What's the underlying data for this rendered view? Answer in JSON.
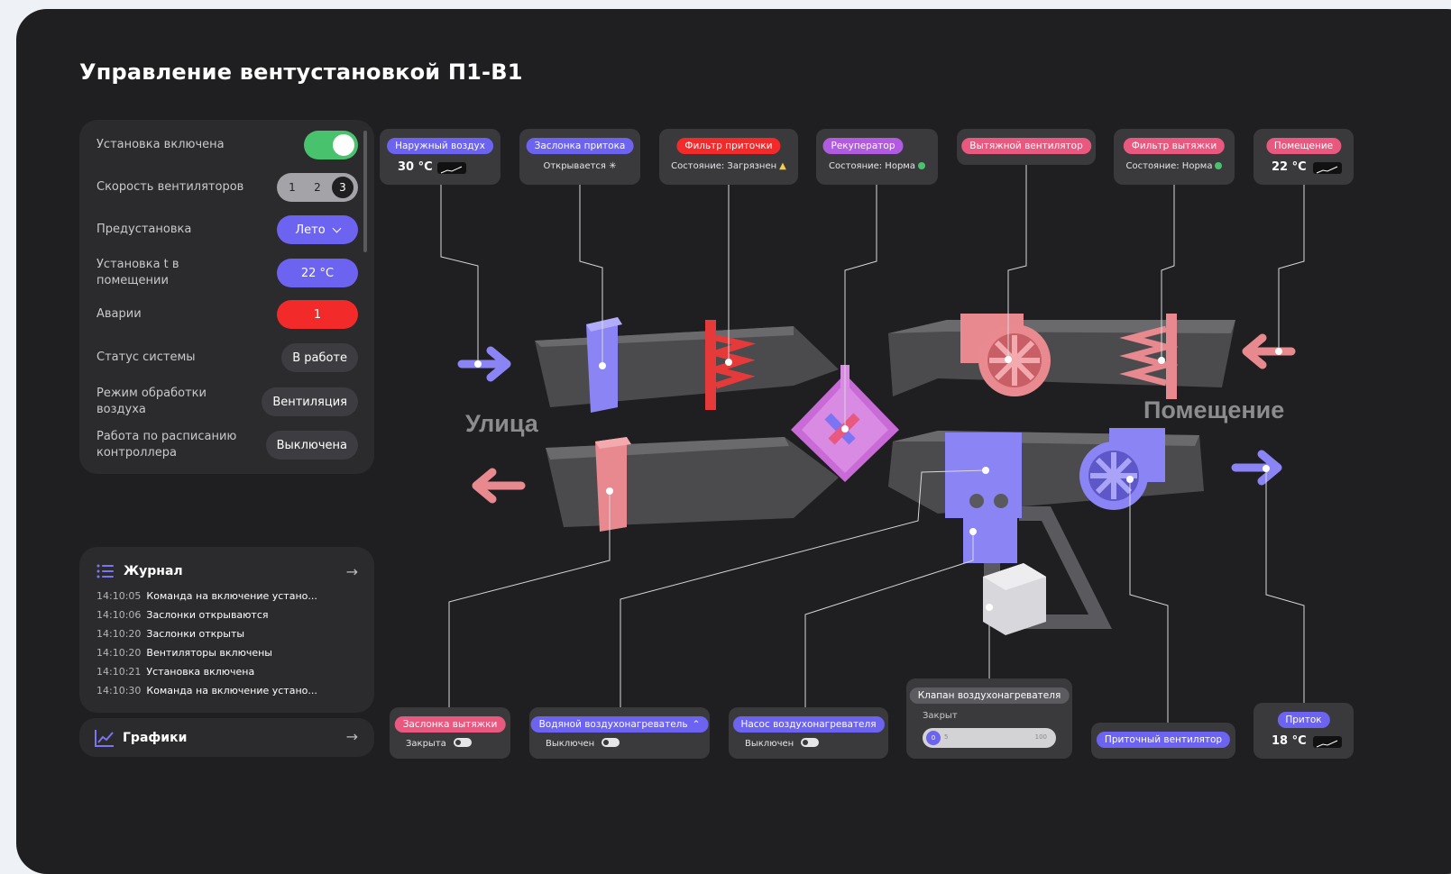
{
  "title": "Управление вентустановкой П1-В1",
  "controls": {
    "power_label": "Установка включена",
    "speed_label": "Скорость вентиляторов",
    "speed_options": [
      "1",
      "2",
      "3"
    ],
    "preset_label": "Предустановка",
    "preset_value": "Лето",
    "room_temp_label": "Установка t в помещении",
    "room_temp_value": "22 °C",
    "alarms_label": "Аварии",
    "alarms_value": "1",
    "status_label": "Статус системы",
    "status_value": "В работе",
    "mode_label": "Режим обработки воздуха",
    "mode_value": "Вентиляция",
    "schedule_label": "Работа по расписанию контроллера",
    "schedule_value": "Выключена"
  },
  "journal": {
    "title": "Журнал",
    "rows": [
      {
        "time": "14:10:05",
        "text": "Команда на включение устано..."
      },
      {
        "time": "14:10:06",
        "text": "Заслонки открываются"
      },
      {
        "time": "14:10:20",
        "text": "Заслонки открыты"
      },
      {
        "time": "14:10:20",
        "text": "Вентиляторы включены"
      },
      {
        "time": "14:10:21",
        "text": "Установка включена"
      },
      {
        "time": "14:10:30",
        "text": "Команда на включение устано..."
      }
    ]
  },
  "graphs": {
    "title": "Графики"
  },
  "diagram": {
    "outdoor_label": "Улица",
    "room_label": "Помещение",
    "top_tags": [
      {
        "chip": "Наружный воздух",
        "value": "30 °C"
      },
      {
        "chip": "Заслонка притока",
        "sub": "Открывается"
      },
      {
        "chip": "Фильтр приточки",
        "sub": "Состояние: Загрязнен"
      },
      {
        "chip": "Рекуператор",
        "sub": "Состояние: Норма"
      },
      {
        "chip": "Вытяжной вентилятор"
      },
      {
        "chip": "Фильтр вытяжки",
        "sub": "Состояние: Норма"
      },
      {
        "chip": "Помещение",
        "value": "22 °C"
      }
    ],
    "bottom_tags": [
      {
        "chip": "Заслонка вытяжки",
        "sub": "Закрыта"
      },
      {
        "chip": "Водяной воздухонагреватель",
        "sub": "Выключен"
      },
      {
        "chip": "Насос воздухонагревателя",
        "sub": "Выключен"
      },
      {
        "chip": "Клапан воздухонагревателя",
        "sub": "Закрыт",
        "slider_value": 0,
        "slider_mid": "5",
        "slider_max": "100"
      },
      {
        "chip": "Приточный вентилятор"
      },
      {
        "chip": "Приток",
        "value": "18 °C"
      }
    ]
  },
  "colors": {
    "accent_blue": "#6c63f0",
    "alarm_red": "#f22a2a",
    "ok_green": "#49c26d",
    "pink": "#e8587f",
    "violet": "#b05be0"
  }
}
